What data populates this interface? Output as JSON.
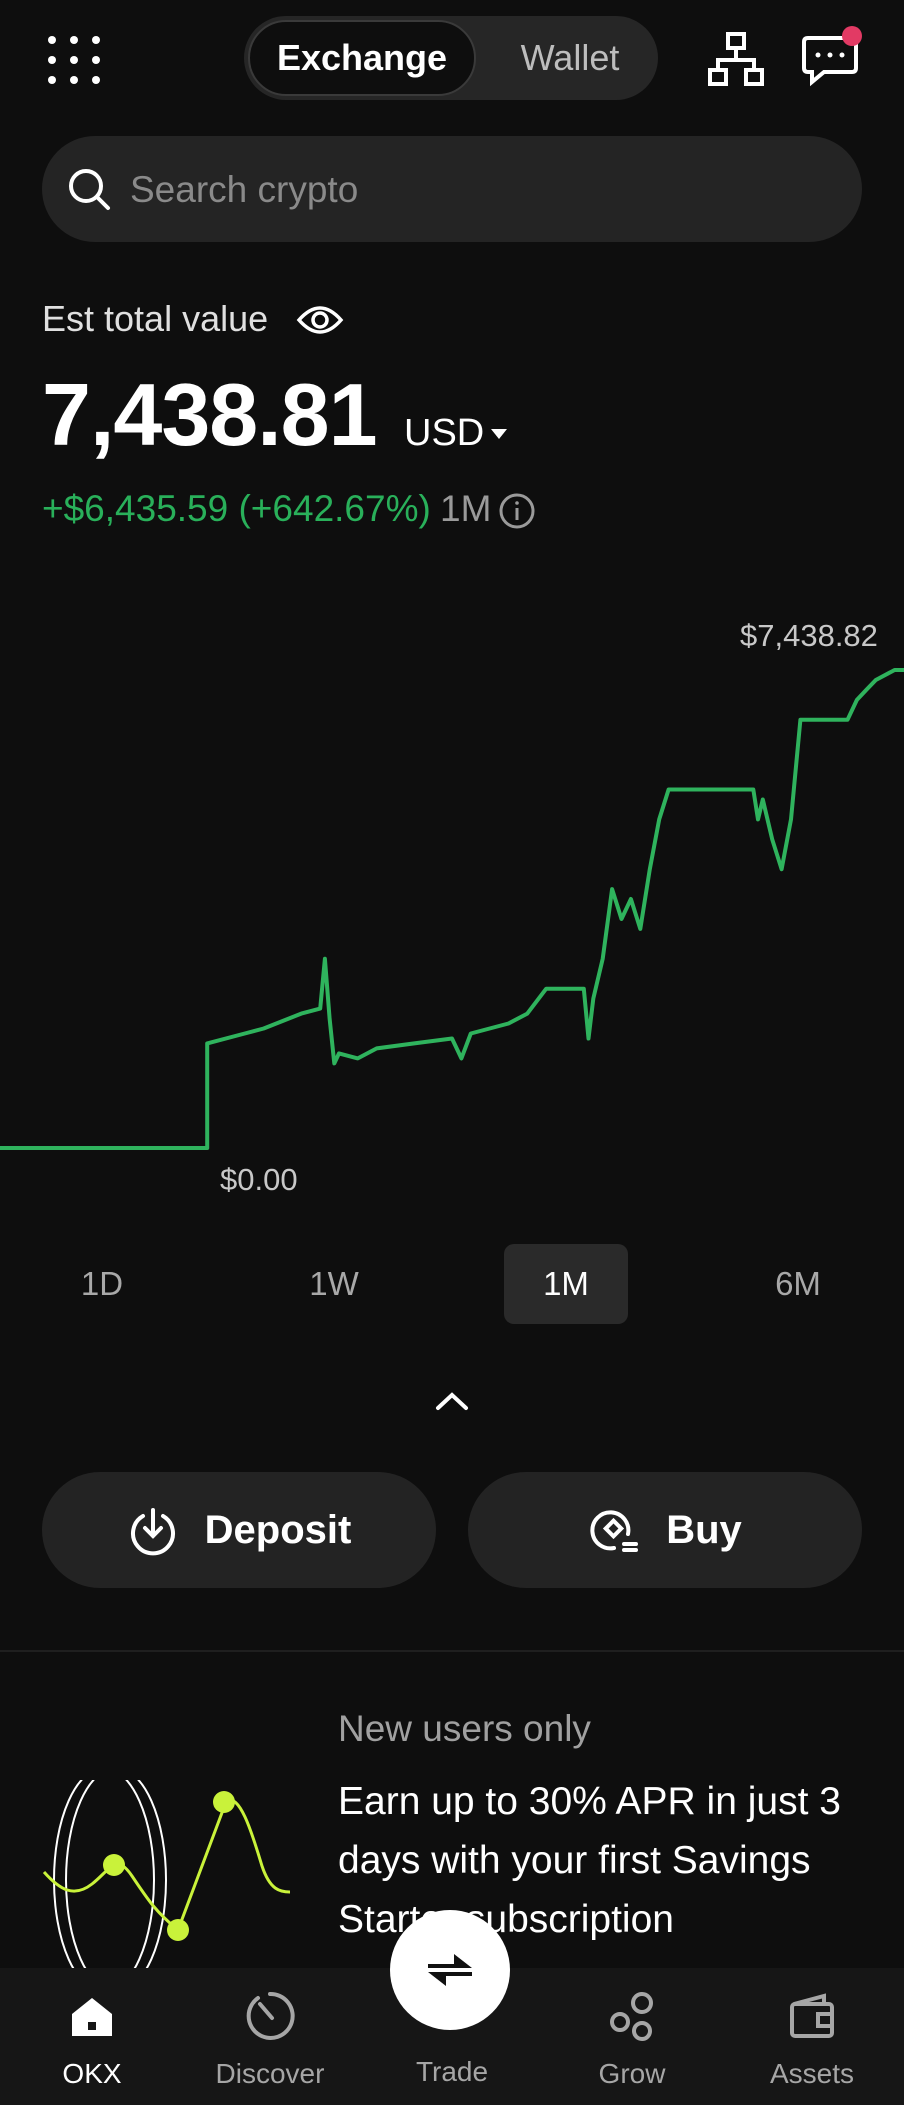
{
  "header": {
    "tabs": [
      "Exchange",
      "Wallet"
    ],
    "active_tab": "Exchange"
  },
  "search": {
    "placeholder": "Search crypto"
  },
  "portfolio": {
    "label": "Est total value",
    "value": "7,438.81",
    "currency": "USD",
    "change": "+$6,435.59 (+642.67%)",
    "period": "1M"
  },
  "chart_data": {
    "type": "line",
    "max_label": "$7,438.82",
    "min_label": "$0.00",
    "line_color": "#2fb35d",
    "points": [
      [
        0,
        0
      ],
      [
        22,
        0
      ],
      [
        22,
        1050
      ],
      [
        26,
        1150
      ],
      [
        28,
        1200
      ],
      [
        32,
        1350
      ],
      [
        34,
        1400
      ],
      [
        34.5,
        1900
      ],
      [
        35,
        1300
      ],
      [
        35.5,
        850
      ],
      [
        36,
        950
      ],
      [
        38,
        900
      ],
      [
        40,
        1000
      ],
      [
        44,
        1050
      ],
      [
        48,
        1100
      ],
      [
        49,
        900
      ],
      [
        50,
        1150
      ],
      [
        54,
        1250
      ],
      [
        56,
        1350
      ],
      [
        58,
        1600
      ],
      [
        62,
        1600
      ],
      [
        62.5,
        1100
      ],
      [
        63,
        1500
      ],
      [
        64,
        1900
      ],
      [
        65,
        2600
      ],
      [
        66,
        2300
      ],
      [
        67,
        2500
      ],
      [
        68,
        2200
      ],
      [
        69,
        2800
      ],
      [
        70,
        3300
      ],
      [
        71,
        3600
      ],
      [
        72,
        3600
      ],
      [
        80,
        3600
      ],
      [
        80.5,
        3300
      ],
      [
        81,
        3500
      ],
      [
        82,
        3100
      ],
      [
        83,
        2800
      ],
      [
        84,
        3300
      ],
      [
        85,
        4300
      ],
      [
        86,
        4300
      ],
      [
        90,
        4300
      ],
      [
        91,
        4500
      ],
      [
        92,
        4600
      ],
      [
        93,
        4700
      ],
      [
        95,
        4800
      ],
      [
        96,
        4800
      ]
    ],
    "y_max": 4800
  },
  "ranges": [
    "1D",
    "1W",
    "1M",
    "6M"
  ],
  "active_range": "1M",
  "actions": {
    "deposit": "Deposit",
    "buy": "Buy"
  },
  "promo": {
    "tag": "New users only",
    "text": "Earn up to 30% APR in just 3 days with your first Savings Starter subscription"
  },
  "nav": {
    "okx": "OKX",
    "discover": "Discover",
    "trade": "Trade",
    "grow": "Grow",
    "assets": "Assets"
  }
}
